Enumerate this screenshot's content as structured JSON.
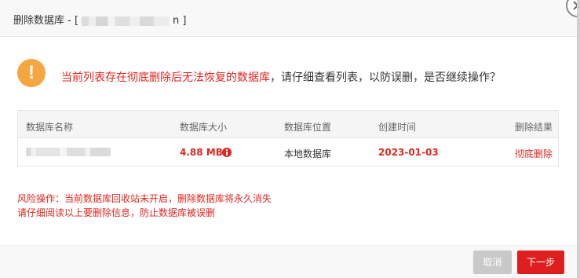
{
  "dialog": {
    "title_prefix": "删除数据库 - [",
    "title_suffix": "n ]"
  },
  "warning": {
    "red_text": "当前列表存在彻底删除后无法恢复的数据库",
    "dark_text": "，请仔细查看列表，以防误删，是否继续操作？",
    "icon_glyph": "!"
  },
  "table": {
    "headers": [
      "数据库名称",
      "数据库大小",
      "数据库位置",
      "创建时间",
      "删除结果"
    ],
    "rows": [
      {
        "size": "4.88 MB",
        "location": "本地数据库",
        "created": "2023-01-03",
        "result": "彻底删除"
      }
    ]
  },
  "risk": {
    "line1": "风险操作：当前数据库回收站未开启，删除数据库将永久消失",
    "line2": "请仔细阅读以上要删除信息，防止数据库被误删"
  },
  "buttons": {
    "cancel": "取消",
    "next": "下一步"
  },
  "colors": {
    "accent_red": "#e0271f",
    "warning_orange": "#f5a641",
    "disabled_gray": "#c9c9c9"
  }
}
